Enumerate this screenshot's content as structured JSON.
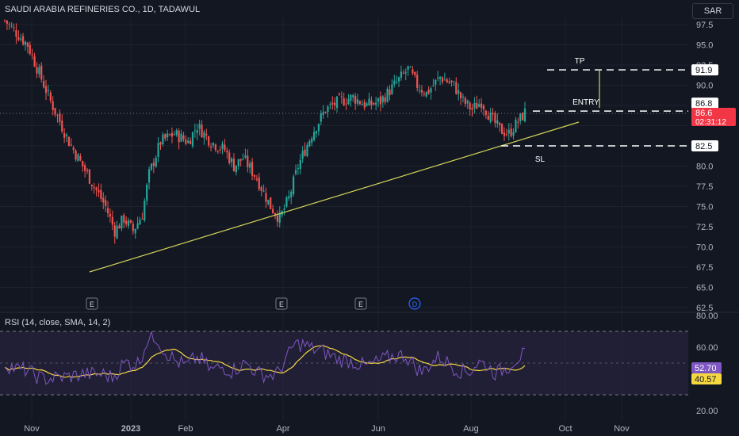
{
  "header": {
    "title": "SAUDI ARABIA REFINERIES CO., 1D, TADAWUL",
    "currency": "SAR"
  },
  "colors": {
    "background": "#131722",
    "up": "#26a69a",
    "down": "#ef5350",
    "trendline": "#d4d45a",
    "rsi_line": "#7e57c2",
    "rsi_sma": "#f5d742",
    "rsi_band": "#2a2440"
  },
  "chart_data": [
    {
      "type": "candlestick",
      "title": "SAUDI ARABIA REFINERIES CO., 1D, TADAWUL",
      "ylim": [
        62.5,
        100.0
      ],
      "y_ticks": [
        62.5,
        65.0,
        67.5,
        70.0,
        72.5,
        75.0,
        77.5,
        80.0,
        82.5,
        85.0,
        87.5,
        90.0,
        92.5,
        95.0,
        97.5
      ],
      "x_ticks": [
        "Nov",
        "2023",
        "Feb",
        "Apr",
        "Jun",
        "Aug",
        "Oct",
        "Nov"
      ],
      "price_path": [
        [
          0,
          98
        ],
        [
          10,
          95
        ],
        [
          20,
          88
        ],
        [
          28,
          83
        ],
        [
          36,
          79
        ],
        [
          44,
          75
        ],
        [
          48,
          72
        ],
        [
          52,
          73.5
        ],
        [
          56,
          72
        ],
        [
          60,
          74
        ],
        [
          63,
          79
        ],
        [
          68,
          83
        ],
        [
          74,
          84
        ],
        [
          80,
          83
        ],
        [
          84,
          85
        ],
        [
          90,
          83
        ],
        [
          96,
          82
        ],
        [
          100,
          80
        ],
        [
          104,
          81
        ],
        [
          110,
          78.5
        ],
        [
          116,
          75
        ],
        [
          120,
          73.5
        ],
        [
          124,
          76
        ],
        [
          128,
          80
        ],
        [
          134,
          84
        ],
        [
          140,
          87
        ],
        [
          146,
          88
        ],
        [
          152,
          88.5
        ],
        [
          158,
          87.5
        ],
        [
          164,
          88
        ],
        [
          170,
          90
        ],
        [
          176,
          92
        ],
        [
          180,
          90
        ],
        [
          184,
          89
        ],
        [
          190,
          91
        ],
        [
          196,
          90
        ],
        [
          200,
          88
        ],
        [
          204,
          87
        ],
        [
          208,
          88
        ],
        [
          212,
          86
        ],
        [
          216,
          84.5
        ],
        [
          220,
          84
        ],
        [
          224,
          85.5
        ],
        [
          227,
          86.6
        ]
      ],
      "price_range_note": "approx daily closes, ~Oct 2022 to Sep 2023",
      "current_price": "86.6",
      "countdown": "02:31:12",
      "trendline": "ascending support from ~67 (Dec 2022) to ~85 (Sep 2023)",
      "levels": [
        {
          "label": "TP",
          "value": "91.9"
        },
        {
          "label": "ENTRY",
          "value": "86.8"
        },
        {
          "label": "SL",
          "value": "82.5"
        }
      ],
      "event_markers": [
        "E",
        "E",
        "E",
        "D"
      ]
    },
    {
      "type": "line",
      "title": "RSI (14, close, SMA, 14, 2)",
      "ylim": [
        20,
        80
      ],
      "y_ticks": [
        "80.00",
        "60.00",
        "20.00"
      ],
      "band": [
        30,
        70
      ],
      "series": [
        {
          "name": "RSI",
          "last": "52.70"
        },
        {
          "name": "SMA",
          "last": "40.57"
        }
      ]
    }
  ]
}
